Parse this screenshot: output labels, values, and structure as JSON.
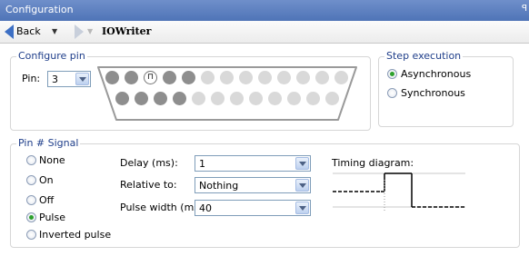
{
  "window": {
    "title": "Configuration",
    "pin_glyph": "ꟼ"
  },
  "toolbar": {
    "back_label": "Back",
    "dropdown_glyph": "▼",
    "page_title": "IOWriter"
  },
  "configure_pin": {
    "legend": "Configure pin",
    "pin_label": "Pin:",
    "pin_value": "3",
    "connector": {
      "top_row": [
        "filled",
        "filled",
        "pulse",
        "filled",
        "filled",
        "empty",
        "empty",
        "empty",
        "empty",
        "empty",
        "empty",
        "empty",
        "empty"
      ],
      "bottom_row": [
        "filled",
        "filled",
        "filled",
        "filled",
        "empty",
        "empty",
        "empty",
        "empty",
        "empty",
        "empty",
        "empty",
        "empty"
      ],
      "pulse_glyph": "⊓"
    }
  },
  "step_execution": {
    "legend": "Step execution",
    "options": [
      {
        "label": "Asynchronous",
        "selected": true
      },
      {
        "label": "Synchronous",
        "selected": false
      }
    ]
  },
  "pin_signal": {
    "legend": "Pin # Signal",
    "options": [
      {
        "label": "None",
        "selected": false
      },
      {
        "label": "On",
        "selected": false
      },
      {
        "label": "Off",
        "selected": false
      },
      {
        "label": "Pulse",
        "selected": true
      },
      {
        "label": "Inverted pulse",
        "selected": false
      }
    ],
    "delay_label": "Delay (ms):",
    "delay_value": "1",
    "relative_label": "Relative to:",
    "relative_value": "Nothing",
    "pulse_width_label": "Pulse width (ms):",
    "pulse_width_value": "40",
    "timing_label": "Timing diagram:"
  },
  "colors": {
    "title_bar": "#5b7fc0",
    "legend_text": "#1f3e8a",
    "radio_selected": "#2da12d",
    "combo_border": "#7f9db9"
  }
}
